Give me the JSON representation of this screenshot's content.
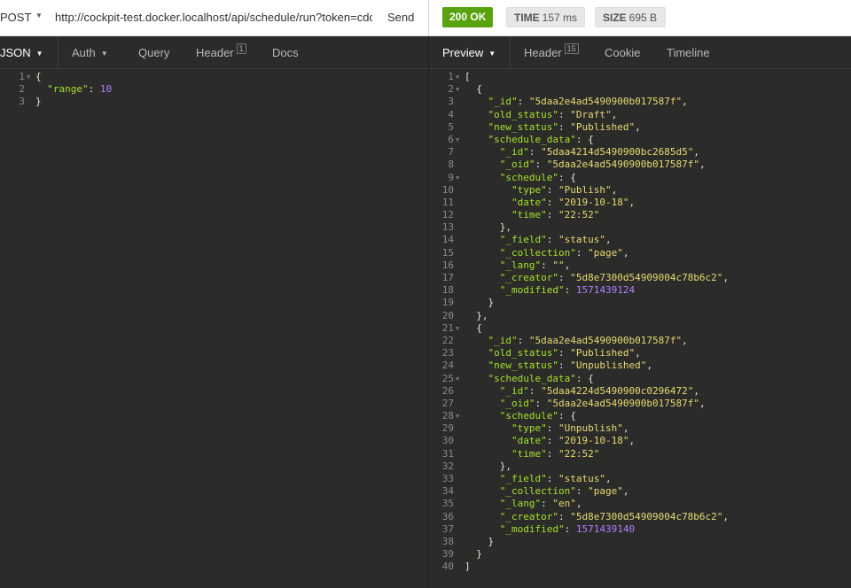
{
  "request": {
    "method": "POST",
    "url": "http://cockpit-test.docker.localhost/api/schedule/run?token=cdda",
    "send_label": "Send"
  },
  "response": {
    "status": "200 OK",
    "time_label": "TIME",
    "time_value": "157 ms",
    "size_label": "SIZE",
    "size_value": "695 B"
  },
  "request_tabs": [
    {
      "label": "JSON",
      "badge": ""
    },
    {
      "label": "Auth",
      "badge": ""
    },
    {
      "label": "Query",
      "badge": ""
    },
    {
      "label": "Header",
      "badge": "1"
    },
    {
      "label": "Docs",
      "badge": ""
    }
  ],
  "response_tabs": [
    {
      "label": "Preview",
      "badge": ""
    },
    {
      "label": "Header",
      "badge": "15"
    },
    {
      "label": "Cookie",
      "badge": ""
    },
    {
      "label": "Timeline",
      "badge": ""
    }
  ],
  "colors": {
    "status_ok": "#59a210",
    "editor_bg": "#2b2b29",
    "key": "#a6e22e",
    "string": "#e6db74",
    "number": "#ae81ff"
  },
  "request_body": [
    {
      "n": "1",
      "fold": true,
      "segs": [
        [
          "p",
          "{"
        ]
      ]
    },
    {
      "n": "2",
      "fold": false,
      "segs": [
        [
          "p",
          "  "
        ],
        [
          "k",
          "\"range\""
        ],
        [
          "p",
          ": "
        ],
        [
          "n",
          "10"
        ]
      ]
    },
    {
      "n": "3",
      "fold": false,
      "segs": [
        [
          "p",
          "}"
        ]
      ]
    }
  ],
  "response_body": [
    {
      "n": "1",
      "fold": true,
      "segs": [
        [
          "p",
          "["
        ]
      ]
    },
    {
      "n": "2",
      "fold": true,
      "segs": [
        [
          "p",
          "  {"
        ]
      ]
    },
    {
      "n": "3",
      "fold": false,
      "segs": [
        [
          "p",
          "    "
        ],
        [
          "k",
          "\"_id\""
        ],
        [
          "p",
          ": "
        ],
        [
          "s",
          "\"5daa2e4ad5490900b017587f\""
        ],
        [
          "p",
          ","
        ]
      ]
    },
    {
      "n": "4",
      "fold": false,
      "segs": [
        [
          "p",
          "    "
        ],
        [
          "k",
          "\"old_status\""
        ],
        [
          "p",
          ": "
        ],
        [
          "s",
          "\"Draft\""
        ],
        [
          "p",
          ","
        ]
      ]
    },
    {
      "n": "5",
      "fold": false,
      "segs": [
        [
          "p",
          "    "
        ],
        [
          "k",
          "\"new_status\""
        ],
        [
          "p",
          ": "
        ],
        [
          "s",
          "\"Published\""
        ],
        [
          "p",
          ","
        ]
      ]
    },
    {
      "n": "6",
      "fold": true,
      "segs": [
        [
          "p",
          "    "
        ],
        [
          "k",
          "\"schedule_data\""
        ],
        [
          "p",
          ": {"
        ]
      ]
    },
    {
      "n": "7",
      "fold": false,
      "segs": [
        [
          "p",
          "      "
        ],
        [
          "k",
          "\"_id\""
        ],
        [
          "p",
          ": "
        ],
        [
          "s",
          "\"5daa4214d5490900bc2685d5\""
        ],
        [
          "p",
          ","
        ]
      ]
    },
    {
      "n": "8",
      "fold": false,
      "segs": [
        [
          "p",
          "      "
        ],
        [
          "k",
          "\"_oid\""
        ],
        [
          "p",
          ": "
        ],
        [
          "s",
          "\"5daa2e4ad5490900b017587f\""
        ],
        [
          "p",
          ","
        ]
      ]
    },
    {
      "n": "9",
      "fold": true,
      "segs": [
        [
          "p",
          "      "
        ],
        [
          "k",
          "\"schedule\""
        ],
        [
          "p",
          ": {"
        ]
      ]
    },
    {
      "n": "10",
      "fold": false,
      "segs": [
        [
          "p",
          "        "
        ],
        [
          "k",
          "\"type\""
        ],
        [
          "p",
          ": "
        ],
        [
          "s",
          "\"Publish\""
        ],
        [
          "p",
          ","
        ]
      ]
    },
    {
      "n": "11",
      "fold": false,
      "segs": [
        [
          "p",
          "        "
        ],
        [
          "k",
          "\"date\""
        ],
        [
          "p",
          ": "
        ],
        [
          "s",
          "\"2019-10-18\""
        ],
        [
          "p",
          ","
        ]
      ]
    },
    {
      "n": "12",
      "fold": false,
      "segs": [
        [
          "p",
          "        "
        ],
        [
          "k",
          "\"time\""
        ],
        [
          "p",
          ": "
        ],
        [
          "s",
          "\"22:52\""
        ]
      ]
    },
    {
      "n": "13",
      "fold": false,
      "segs": [
        [
          "p",
          "      },"
        ]
      ]
    },
    {
      "n": "14",
      "fold": false,
      "segs": [
        [
          "p",
          "      "
        ],
        [
          "k",
          "\"_field\""
        ],
        [
          "p",
          ": "
        ],
        [
          "s",
          "\"status\""
        ],
        [
          "p",
          ","
        ]
      ]
    },
    {
      "n": "15",
      "fold": false,
      "segs": [
        [
          "p",
          "      "
        ],
        [
          "k",
          "\"_collection\""
        ],
        [
          "p",
          ": "
        ],
        [
          "s",
          "\"page\""
        ],
        [
          "p",
          ","
        ]
      ]
    },
    {
      "n": "16",
      "fold": false,
      "segs": [
        [
          "p",
          "      "
        ],
        [
          "k",
          "\"_lang\""
        ],
        [
          "p",
          ": "
        ],
        [
          "s",
          "\"\""
        ],
        [
          "p",
          ","
        ]
      ]
    },
    {
      "n": "17",
      "fold": false,
      "segs": [
        [
          "p",
          "      "
        ],
        [
          "k",
          "\"_creator\""
        ],
        [
          "p",
          ": "
        ],
        [
          "s",
          "\"5d8e7300d54909004c78b6c2\""
        ],
        [
          "p",
          ","
        ]
      ]
    },
    {
      "n": "18",
      "fold": false,
      "segs": [
        [
          "p",
          "      "
        ],
        [
          "k",
          "\"_modified\""
        ],
        [
          "p",
          ": "
        ],
        [
          "n",
          "1571439124"
        ]
      ]
    },
    {
      "n": "19",
      "fold": false,
      "segs": [
        [
          "p",
          "    }"
        ]
      ]
    },
    {
      "n": "20",
      "fold": false,
      "segs": [
        [
          "p",
          "  },"
        ]
      ]
    },
    {
      "n": "21",
      "fold": true,
      "segs": [
        [
          "p",
          "  {"
        ]
      ]
    },
    {
      "n": "22",
      "fold": false,
      "segs": [
        [
          "p",
          "    "
        ],
        [
          "k",
          "\"_id\""
        ],
        [
          "p",
          ": "
        ],
        [
          "s",
          "\"5daa2e4ad5490900b017587f\""
        ],
        [
          "p",
          ","
        ]
      ]
    },
    {
      "n": "23",
      "fold": false,
      "segs": [
        [
          "p",
          "    "
        ],
        [
          "k",
          "\"old_status\""
        ],
        [
          "p",
          ": "
        ],
        [
          "s",
          "\"Published\""
        ],
        [
          "p",
          ","
        ]
      ]
    },
    {
      "n": "24",
      "fold": false,
      "segs": [
        [
          "p",
          "    "
        ],
        [
          "k",
          "\"new_status\""
        ],
        [
          "p",
          ": "
        ],
        [
          "s",
          "\"Unpublished\""
        ],
        [
          "p",
          ","
        ]
      ]
    },
    {
      "n": "25",
      "fold": true,
      "segs": [
        [
          "p",
          "    "
        ],
        [
          "k",
          "\"schedule_data\""
        ],
        [
          "p",
          ": {"
        ]
      ]
    },
    {
      "n": "26",
      "fold": false,
      "segs": [
        [
          "p",
          "      "
        ],
        [
          "k",
          "\"_id\""
        ],
        [
          "p",
          ": "
        ],
        [
          "s",
          "\"5daa4224d5490900c0296472\""
        ],
        [
          "p",
          ","
        ]
      ]
    },
    {
      "n": "27",
      "fold": false,
      "segs": [
        [
          "p",
          "      "
        ],
        [
          "k",
          "\"_oid\""
        ],
        [
          "p",
          ": "
        ],
        [
          "s",
          "\"5daa2e4ad5490900b017587f\""
        ],
        [
          "p",
          ","
        ]
      ]
    },
    {
      "n": "28",
      "fold": true,
      "segs": [
        [
          "p",
          "      "
        ],
        [
          "k",
          "\"schedule\""
        ],
        [
          "p",
          ": {"
        ]
      ]
    },
    {
      "n": "29",
      "fold": false,
      "segs": [
        [
          "p",
          "        "
        ],
        [
          "k",
          "\"type\""
        ],
        [
          "p",
          ": "
        ],
        [
          "s",
          "\"Unpublish\""
        ],
        [
          "p",
          ","
        ]
      ]
    },
    {
      "n": "30",
      "fold": false,
      "segs": [
        [
          "p",
          "        "
        ],
        [
          "k",
          "\"date\""
        ],
        [
          "p",
          ": "
        ],
        [
          "s",
          "\"2019-10-18\""
        ],
        [
          "p",
          ","
        ]
      ]
    },
    {
      "n": "31",
      "fold": false,
      "segs": [
        [
          "p",
          "        "
        ],
        [
          "k",
          "\"time\""
        ],
        [
          "p",
          ": "
        ],
        [
          "s",
          "\"22:52\""
        ]
      ]
    },
    {
      "n": "32",
      "fold": false,
      "segs": [
        [
          "p",
          "      },"
        ]
      ]
    },
    {
      "n": "33",
      "fold": false,
      "segs": [
        [
          "p",
          "      "
        ],
        [
          "k",
          "\"_field\""
        ],
        [
          "p",
          ": "
        ],
        [
          "s",
          "\"status\""
        ],
        [
          "p",
          ","
        ]
      ]
    },
    {
      "n": "34",
      "fold": false,
      "segs": [
        [
          "p",
          "      "
        ],
        [
          "k",
          "\"_collection\""
        ],
        [
          "p",
          ": "
        ],
        [
          "s",
          "\"page\""
        ],
        [
          "p",
          ","
        ]
      ]
    },
    {
      "n": "35",
      "fold": false,
      "segs": [
        [
          "p",
          "      "
        ],
        [
          "k",
          "\"_lang\""
        ],
        [
          "p",
          ": "
        ],
        [
          "s",
          "\"en\""
        ],
        [
          "p",
          ","
        ]
      ]
    },
    {
      "n": "36",
      "fold": false,
      "segs": [
        [
          "p",
          "      "
        ],
        [
          "k",
          "\"_creator\""
        ],
        [
          "p",
          ": "
        ],
        [
          "s",
          "\"5d8e7300d54909004c78b6c2\""
        ],
        [
          "p",
          ","
        ]
      ]
    },
    {
      "n": "37",
      "fold": false,
      "segs": [
        [
          "p",
          "      "
        ],
        [
          "k",
          "\"_modified\""
        ],
        [
          "p",
          ": "
        ],
        [
          "n",
          "1571439140"
        ]
      ]
    },
    {
      "n": "38",
      "fold": false,
      "segs": [
        [
          "p",
          "    }"
        ]
      ]
    },
    {
      "n": "39",
      "fold": false,
      "segs": [
        [
          "p",
          "  }"
        ]
      ]
    },
    {
      "n": "40",
      "fold": false,
      "segs": [
        [
          "p",
          "]"
        ]
      ]
    }
  ]
}
